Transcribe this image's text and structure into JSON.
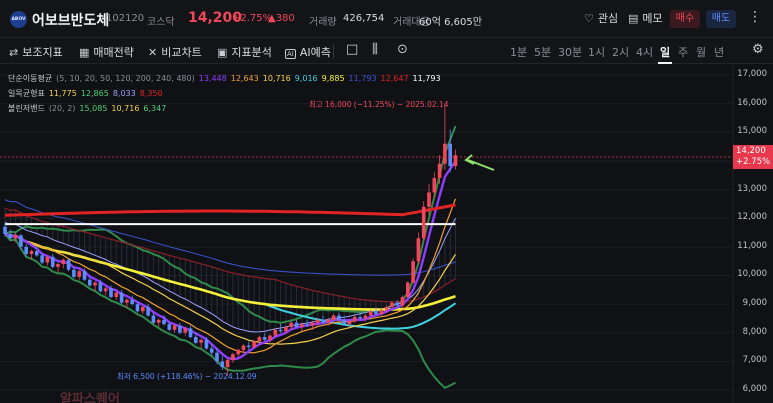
{
  "header": {
    "logo_text": "ABOV",
    "stock_name": "어보브반도체",
    "code": "102120",
    "market": "코스닥",
    "price": "14,200",
    "change_pct": "+2.75%",
    "change": "▲380",
    "volume_label": "거래량",
    "volume": "426,754",
    "amount_label": "거래대금",
    "amount": "60억 6,605만",
    "watchlist_label": "관심",
    "memo_label": "메모",
    "buy_label": "매수",
    "sell_label": "매도",
    "colors": {
      "up": "#f2475a",
      "down": "#5b8dff"
    }
  },
  "toolbar": {
    "indicators_label": "보조지표",
    "strategy_label": "매매전략",
    "compare_label": "비교차트",
    "pattern_label": "지표분석",
    "ai_label": "AI예측",
    "periods": [
      "1분",
      "5분",
      "30분",
      "1시",
      "2시",
      "4시",
      "일",
      "주",
      "월",
      "년"
    ],
    "active_period": "일"
  },
  "legend": {
    "ma": {
      "name": "단순이동평균",
      "params": "(5, 10, 20, 50, 120, 200, 240, 480)",
      "values": [
        {
          "v": "13,448",
          "color": "#8f3cff"
        },
        {
          "v": "12,643",
          "color": "#f0a030"
        },
        {
          "v": "10,716",
          "color": "#f5d24a"
        },
        {
          "v": "9,016",
          "color": "#3fd1e0"
        },
        {
          "v": "9,885",
          "color": "#f5f03a"
        },
        {
          "v": "11,793",
          "color": "#3a56d6"
        },
        {
          "v": "12,647",
          "color": "#e02424"
        },
        {
          "v": "11,793",
          "color": "#ffffff"
        }
      ]
    },
    "ichimoku": {
      "name": "일목균형표",
      "values": [
        {
          "v": "11,775",
          "color": "#f5d24a"
        },
        {
          "v": "12,865",
          "color": "#4ed07a"
        },
        {
          "v": "8,033",
          "color": "#9aa0ff"
        },
        {
          "v": "8,350",
          "color": "#e02424"
        }
      ]
    },
    "bollinger": {
      "name": "볼린저밴드",
      "params": "(20, 2)",
      "values": [
        {
          "v": "15,085",
          "color": "#4ed07a"
        },
        {
          "v": "10,716",
          "color": "#f5d24a"
        },
        {
          "v": "6,347",
          "color": "#4ed07a"
        }
      ]
    }
  },
  "annotations": {
    "high": "최고 16,000 (−11.25%) − 2025.02.14",
    "low": "최저 6,500 (+118.46%) − 2024.12.09"
  },
  "watermark": "알파스퀘어",
  "price_tag": {
    "price": "14,200",
    "pct": "+2.75%"
  },
  "chart_data": {
    "type": "candlestick",
    "y_ticks": [
      "17,000",
      "16,000",
      "15,000",
      "14,000",
      "13,000",
      "12,000",
      "11,000",
      "10,000",
      "9,000",
      "8,000",
      "7,000",
      "6,000"
    ],
    "ylim": [
      5800,
      17200
    ],
    "current_price": 14200,
    "high": {
      "value": 16000,
      "date": "2025.02.14"
    },
    "low": {
      "value": 6500,
      "date": "2024.12.09"
    },
    "ohlc": [
      [
        11700,
        11850,
        11350,
        11450
      ],
      [
        11450,
        11600,
        11200,
        11300
      ],
      [
        11300,
        11500,
        11150,
        11400
      ],
      [
        11400,
        11450,
        10900,
        11000
      ],
      [
        11000,
        11100,
        10650,
        10750
      ],
      [
        10750,
        10900,
        10550,
        10850
      ],
      [
        10850,
        11000,
        10650,
        10700
      ],
      [
        10700,
        10800,
        10400,
        10450
      ],
      [
        10450,
        10700,
        10350,
        10650
      ],
      [
        10650,
        10750,
        10250,
        10300
      ],
      [
        10300,
        10450,
        10100,
        10400
      ],
      [
        10400,
        10600,
        10250,
        10550
      ],
      [
        10550,
        10600,
        10150,
        10200
      ],
      [
        10200,
        10300,
        9900,
        9950
      ],
      [
        9950,
        10200,
        9850,
        10150
      ],
      [
        10150,
        10250,
        9800,
        9850
      ],
      [
        9850,
        9950,
        9600,
        9650
      ],
      [
        9650,
        9800,
        9450,
        9750
      ],
      [
        9750,
        9850,
        9400,
        9450
      ],
      [
        9450,
        9600,
        9300,
        9550
      ],
      [
        9550,
        9650,
        9200,
        9250
      ],
      [
        9250,
        9450,
        9150,
        9400
      ],
      [
        9400,
        9500,
        9000,
        9050
      ],
      [
        9050,
        9200,
        8850,
        9150
      ],
      [
        9150,
        9300,
        8950,
        9000
      ],
      [
        9000,
        9100,
        8700,
        8750
      ],
      [
        8750,
        8950,
        8650,
        8900
      ],
      [
        8900,
        9000,
        8550,
        8600
      ],
      [
        8600,
        8700,
        8300,
        8350
      ],
      [
        8350,
        8500,
        8200,
        8450
      ],
      [
        8450,
        8600,
        8250,
        8300
      ],
      [
        8300,
        8400,
        8050,
        8100
      ],
      [
        8100,
        8300,
        8000,
        8250
      ],
      [
        8250,
        8350,
        7950,
        8000
      ],
      [
        8000,
        8200,
        7900,
        8150
      ],
      [
        8150,
        8250,
        7800,
        7850
      ],
      [
        7850,
        8000,
        7600,
        7650
      ],
      [
        7650,
        7800,
        7450,
        7750
      ],
      [
        7750,
        7850,
        7400,
        7450
      ],
      [
        7450,
        7600,
        7200,
        7300
      ],
      [
        7300,
        7450,
        6900,
        7000
      ],
      [
        7000,
        7200,
        6700,
        6800
      ],
      [
        6800,
        7100,
        6500,
        7050
      ],
      [
        7050,
        7300,
        6950,
        7250
      ],
      [
        7250,
        7450,
        7150,
        7400
      ],
      [
        7400,
        7600,
        7300,
        7550
      ],
      [
        7550,
        7700,
        7400,
        7500
      ],
      [
        7500,
        7750,
        7450,
        7700
      ],
      [
        7700,
        7900,
        7600,
        7850
      ],
      [
        7850,
        8000,
        7700,
        7750
      ],
      [
        7750,
        7950,
        7650,
        7900
      ],
      [
        7900,
        8150,
        7850,
        8100
      ],
      [
        8100,
        8300,
        8000,
        8050
      ],
      [
        8050,
        8250,
        7950,
        8200
      ],
      [
        8200,
        8400,
        8100,
        8350
      ],
      [
        8350,
        8450,
        8150,
        8200
      ],
      [
        8200,
        8350,
        8050,
        8300
      ],
      [
        8300,
        8450,
        8200,
        8250
      ],
      [
        8250,
        8400,
        8100,
        8350
      ],
      [
        8350,
        8500,
        8250,
        8450
      ],
      [
        8450,
        8600,
        8300,
        8350
      ],
      [
        8350,
        8500,
        8250,
        8450
      ],
      [
        8450,
        8650,
        8400,
        8600
      ],
      [
        8600,
        8700,
        8400,
        8450
      ],
      [
        8450,
        8550,
        8250,
        8300
      ],
      [
        8300,
        8450,
        8200,
        8400
      ],
      [
        8400,
        8600,
        8350,
        8550
      ],
      [
        8550,
        8700,
        8450,
        8500
      ],
      [
        8500,
        8650,
        8400,
        8600
      ],
      [
        8600,
        8800,
        8550,
        8750
      ],
      [
        8750,
        8900,
        8600,
        8650
      ],
      [
        8650,
        8850,
        8600,
        8800
      ],
      [
        8800,
        8950,
        8700,
        8900
      ],
      [
        8900,
        9100,
        8850,
        9050
      ],
      [
        9050,
        9150,
        8850,
        8950
      ],
      [
        8950,
        9300,
        8900,
        9250
      ],
      [
        9250,
        9800,
        9200,
        9750
      ],
      [
        9750,
        10600,
        9700,
        10500
      ],
      [
        10500,
        11500,
        10400,
        11300
      ],
      [
        11300,
        12600,
        11200,
        12400
      ],
      [
        12400,
        13200,
        12100,
        12900
      ],
      [
        12900,
        13600,
        12700,
        13400
      ],
      [
        13400,
        14200,
        13200,
        13900
      ],
      [
        13900,
        16000,
        13700,
        14600
      ],
      [
        14600,
        15100,
        13600,
        13820
      ],
      [
        13820,
        14400,
        13700,
        14200
      ]
    ]
  }
}
